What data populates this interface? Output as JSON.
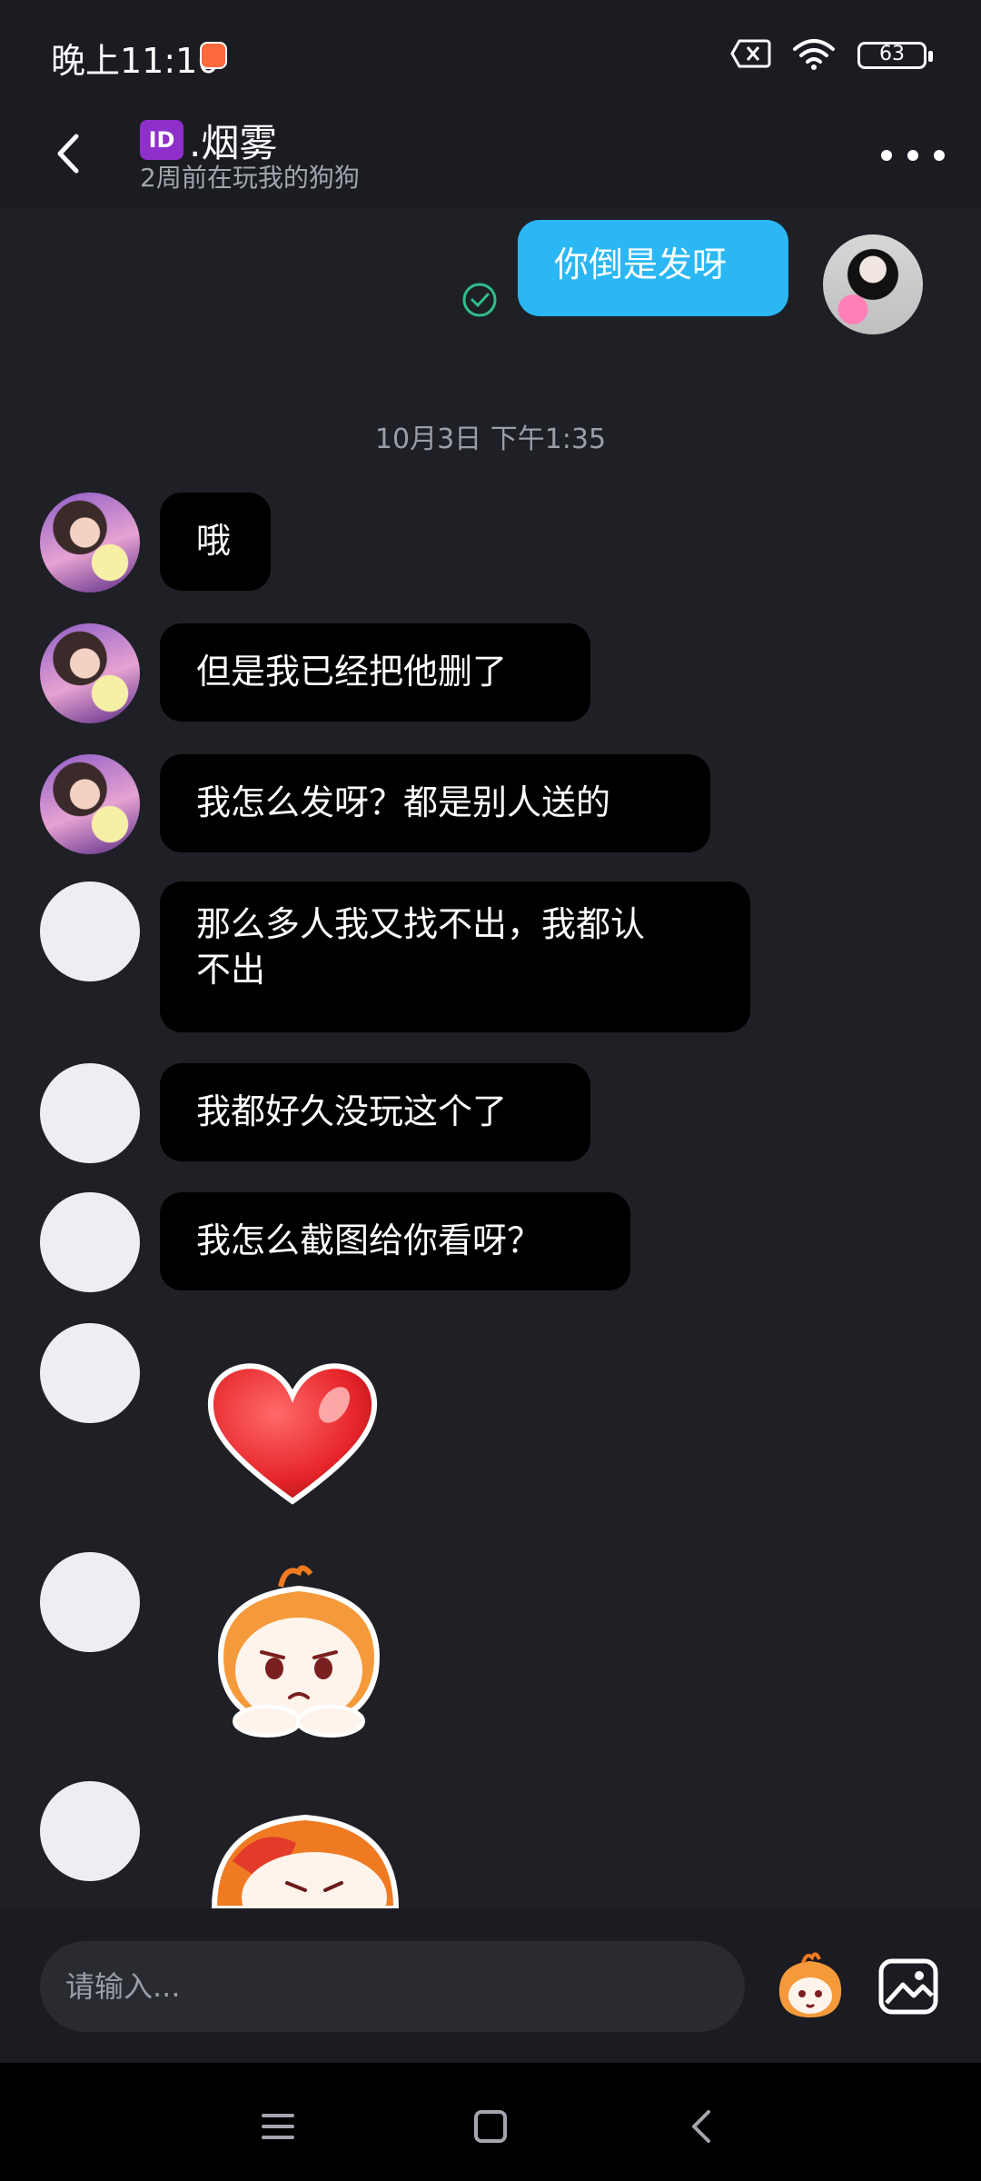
{
  "status_bar": {
    "time": "晚上11:10",
    "battery": "63"
  },
  "header": {
    "badge": "ID",
    "title": ".烟雾",
    "subtitle": "2周前在玩我的狗狗"
  },
  "chat": {
    "my_message": "你倒是发呀",
    "time_divider": "10月3日 下午1:35",
    "messages": [
      {
        "text": "哦"
      },
      {
        "text": "但是我已经把他删了"
      },
      {
        "text": "我怎么发呀？都是别人送的"
      },
      {
        "text_line1": "那么多人我又找不出，我都认",
        "text_line2": "不出"
      },
      {
        "text": "我都好久没玩这个了"
      },
      {
        "text": "我怎么截图给你看呀？"
      }
    ],
    "stickers": [
      "heart-sticker",
      "sad-fox-sticker",
      "fox-sticker-partial"
    ]
  },
  "composer": {
    "placeholder": "请输入..."
  },
  "icons": {
    "back": "back-arrow-icon",
    "more": "more-icon",
    "sim": "no-sim-icon",
    "wifi": "wifi-icon",
    "check": "check-circle-icon",
    "emoji": "mascot-emoji-icon",
    "image": "image-icon",
    "nav_menu": "menu-icon",
    "nav_home": "home-icon",
    "nav_back": "back-icon"
  },
  "colors": {
    "background": "#1f2026",
    "bar": "#1b1c21",
    "my_bubble": "#2ab7f4",
    "their_bubble": "#000000",
    "check": "#2fbf8a"
  }
}
